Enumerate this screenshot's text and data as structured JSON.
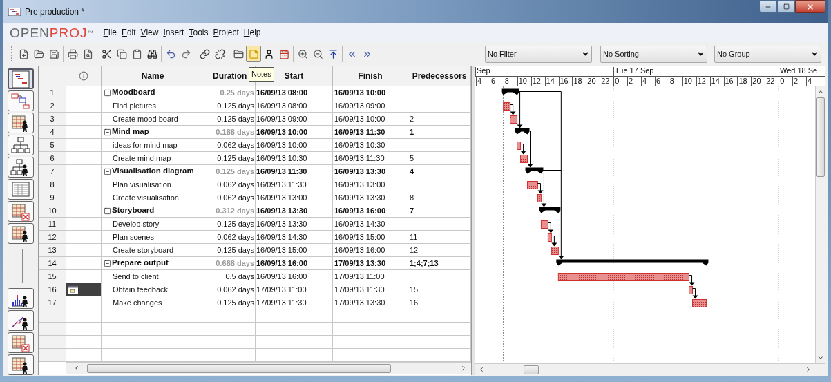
{
  "window": {
    "title": "Pre production *"
  },
  "logo": {
    "first": "OPEN",
    "second": "PROJ",
    "mark": "™"
  },
  "menu": [
    "File",
    "Edit",
    "View",
    "Insert",
    "Tools",
    "Project",
    "Help"
  ],
  "toolbar": [
    [
      {
        "kind": "new",
        "pressed": false
      },
      {
        "kind": "open",
        "pressed": false
      },
      {
        "kind": "save",
        "pressed": false
      }
    ],
    [
      {
        "kind": "print",
        "pressed": false
      },
      {
        "kind": "preview",
        "pressed": false
      }
    ],
    [
      {
        "kind": "cut",
        "pressed": false
      },
      {
        "kind": "copy",
        "pressed": false
      },
      {
        "kind": "paste",
        "pressed": false
      },
      {
        "kind": "find",
        "pressed": false
      }
    ],
    [
      {
        "kind": "undo",
        "pressed": false
      },
      {
        "kind": "redo",
        "pressed": false
      }
    ],
    [
      {
        "kind": "link",
        "pressed": false
      },
      {
        "kind": "unlink",
        "pressed": false
      }
    ],
    [
      {
        "kind": "info",
        "pressed": false
      },
      {
        "kind": "notes",
        "pressed": true
      },
      {
        "kind": "resource",
        "pressed": false
      },
      {
        "kind": "calendar",
        "pressed": false
      }
    ],
    [
      {
        "kind": "zoom-in",
        "pressed": false
      },
      {
        "kind": "zoom-out",
        "pressed": false
      },
      {
        "kind": "scroll-to",
        "pressed": false
      }
    ],
    [
      {
        "kind": "previous",
        "pressed": false
      },
      {
        "kind": "next",
        "pressed": false
      }
    ]
  ],
  "tooltip": {
    "text": "Notes"
  },
  "dropdowns": [
    {
      "value": "No Filter"
    },
    {
      "value": "No Sorting"
    },
    {
      "value": "No Group"
    }
  ],
  "views": [
    [
      {
        "kind": "gantt",
        "selected": true
      },
      {
        "kind": "network",
        "selected": false
      },
      {
        "kind": "resources",
        "selected": false
      },
      {
        "kind": "wbs",
        "selected": false
      },
      {
        "kind": "rbs",
        "selected": false
      },
      {
        "kind": "report",
        "selected": false
      },
      {
        "kind": "task-usage",
        "selected": false
      },
      {
        "kind": "resource-usage",
        "selected": false
      }
    ],
    [
      {
        "kind": "histogram",
        "selected": false
      },
      {
        "kind": "charts",
        "selected": false
      },
      {
        "kind": "task-usage",
        "selected": false
      },
      {
        "kind": "resource-usage",
        "selected": false
      }
    ]
  ],
  "table": {
    "columns": [
      "Name",
      "Duration",
      "Start",
      "Finish",
      "Predecessors"
    ],
    "rows": [
      {
        "number": "1",
        "kind": "summary",
        "expanded": true,
        "selected": false,
        "note": false,
        "name": "Moodboard",
        "duration": "0.25 days",
        "start": "16/09/13 08:00",
        "finish": "16/09/13 10:00",
        "children": [
          {
            "number": "2",
            "kind": "task",
            "selected": false,
            "note": false,
            "name": "Find pictures",
            "duration": "0.125 days",
            "start": "16/09/13 08:00",
            "finish": "16/09/13 09:00"
          },
          {
            "number": "3",
            "kind": "task",
            "selected": false,
            "note": false,
            "name": "Create mood board",
            "duration": "0.125 days",
            "start": "16/09/13 09:00",
            "finish": "16/09/13 10:00",
            "predecessors": "2"
          }
        ]
      },
      {
        "number": "4",
        "kind": "summary",
        "expanded": true,
        "selected": false,
        "note": false,
        "name": "Mind map",
        "duration": "0.188 days",
        "start": "16/09/13 10:00",
        "finish": "16/09/13 11:30",
        "predecessors": "1",
        "children": [
          {
            "number": "5",
            "kind": "task",
            "selected": false,
            "note": false,
            "name": "ideas for mind map",
            "duration": "0.062 days",
            "start": "16/09/13 10:00",
            "finish": "16/09/13 10:30"
          },
          {
            "number": "6",
            "kind": "task",
            "selected": false,
            "note": false,
            "name": "Create mind map",
            "duration": "0.125 days",
            "start": "16/09/13 10:30",
            "finish": "16/09/13 11:30",
            "predecessors": "5"
          }
        ]
      },
      {
        "number": "7",
        "kind": "summary",
        "expanded": true,
        "selected": false,
        "note": false,
        "name": "Visualisation diagram",
        "duration": "0.125 days",
        "start": "16/09/13 11:30",
        "finish": "16/09/13 13:30",
        "predecessors": "4",
        "children": [
          {
            "number": "8",
            "kind": "task",
            "selected": false,
            "note": false,
            "name": "Plan visualisation",
            "duration": "0.062 days",
            "start": "16/09/13 11:30",
            "finish": "16/09/13 13:00"
          },
          {
            "number": "9",
            "kind": "task",
            "selected": false,
            "note": false,
            "name": "Create visualisation",
            "duration": "0.062 days",
            "start": "16/09/13 13:00",
            "finish": "16/09/13 13:30",
            "predecessors": "8"
          }
        ]
      },
      {
        "number": "10",
        "kind": "summary",
        "expanded": true,
        "selected": false,
        "note": false,
        "name": "Storyboard",
        "duration": "0.312 days",
        "start": "16/09/13 13:30",
        "finish": "16/09/13 16:00",
        "predecessors": "7",
        "children": [
          {
            "number": "11",
            "kind": "task",
            "selected": false,
            "note": false,
            "name": "Develop story",
            "duration": "0.125 days",
            "start": "16/09/13 13:30",
            "finish": "16/09/13 14:30"
          },
          {
            "number": "12",
            "kind": "task",
            "selected": false,
            "note": false,
            "name": "Plan scenes",
            "duration": "0.062 days",
            "start": "16/09/13 14:30",
            "finish": "16/09/13 15:00",
            "predecessors": "11"
          },
          {
            "number": "13",
            "kind": "task",
            "selected": false,
            "note": false,
            "name": "Create storyboard",
            "duration": "0.125 days",
            "start": "16/09/13 15:00",
            "finish": "16/09/13 16:00",
            "predecessors": "12"
          }
        ]
      },
      {
        "number": "14",
        "kind": "summary",
        "expanded": true,
        "selected": false,
        "note": false,
        "name": "Prepare output",
        "duration": "0.688 days",
        "start": "16/09/13 16:00",
        "finish": "17/09/13 13:30",
        "predecessors": "1;4;7;13",
        "children": [
          {
            "number": "15",
            "kind": "task",
            "selected": false,
            "note": false,
            "name": "Send to client",
            "duration": "0.5 days",
            "start": "16/09/13 16:00",
            "finish": "17/09/13 11:00"
          },
          {
            "number": "16",
            "kind": "task",
            "selected": true,
            "note": true,
            "name": "Obtain feedback",
            "duration": "0.062 days",
            "start": "17/09/13 11:00",
            "finish": "17/09/13 11:30",
            "predecessors": "15"
          },
          {
            "number": "17",
            "kind": "task",
            "selected": false,
            "note": false,
            "name": "Make changes",
            "duration": "0.125 days",
            "start": "17/09/13 11:30",
            "finish": "17/09/13 13:30",
            "predecessors": "16"
          }
        ]
      }
    ]
  },
  "gantt": {
    "days": [
      "Sep",
      "Tue 17 Sep",
      "Wed 18 Se"
    ],
    "hours": [
      "4",
      "6",
      "8",
      "10",
      "12",
      "14",
      "16",
      "18",
      "20",
      "22",
      "0",
      "2",
      "4",
      "6",
      "8",
      "10",
      "12",
      "14",
      "16",
      "18",
      "20",
      "22",
      "0",
      "2",
      "4"
    ]
  }
}
